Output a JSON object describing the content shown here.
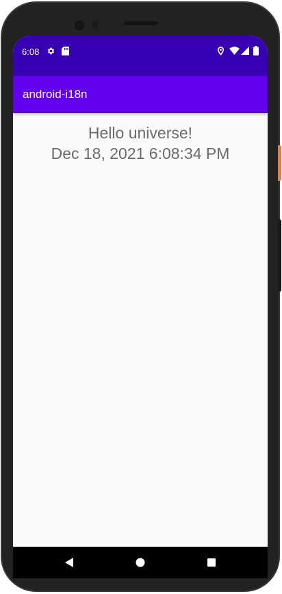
{
  "status_bar": {
    "time": "6:08",
    "icons": [
      "gear-icon",
      "sd-card-icon",
      "location-icon",
      "wifi-icon",
      "signal-icon",
      "battery-icon"
    ],
    "color": "#3700b3"
  },
  "app_bar": {
    "title": "android-i18n",
    "color": "#6200ee"
  },
  "content": {
    "greeting": "Hello universe!",
    "datetime": "Dec 18, 2021 6:08:34 PM"
  },
  "nav_bar": {
    "buttons": [
      "back-icon",
      "home-icon",
      "recents-icon"
    ]
  }
}
